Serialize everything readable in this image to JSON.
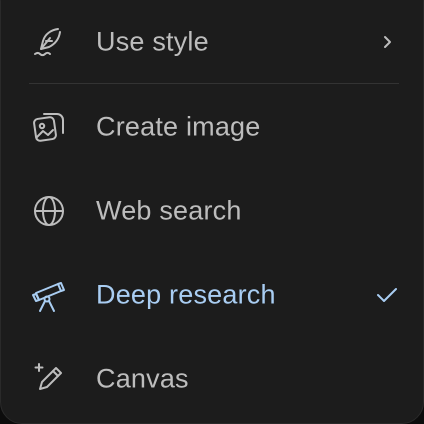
{
  "menu": {
    "items": [
      {
        "label": "Use style",
        "icon": "feather-icon",
        "trailing": "chevron-right-icon",
        "active": false
      },
      {
        "label": "Create image",
        "icon": "image-icon",
        "active": false
      },
      {
        "label": "Web search",
        "icon": "globe-icon",
        "active": false
      },
      {
        "label": "Deep research",
        "icon": "telescope-icon",
        "trailing": "check-icon",
        "active": true
      },
      {
        "label": "Canvas",
        "icon": "pen-sparkle-icon",
        "active": false
      }
    ],
    "colors": {
      "background": "#1c1c1c",
      "text": "#bdbdbd",
      "active": "#a9cdf2",
      "divider": "#333333"
    }
  }
}
